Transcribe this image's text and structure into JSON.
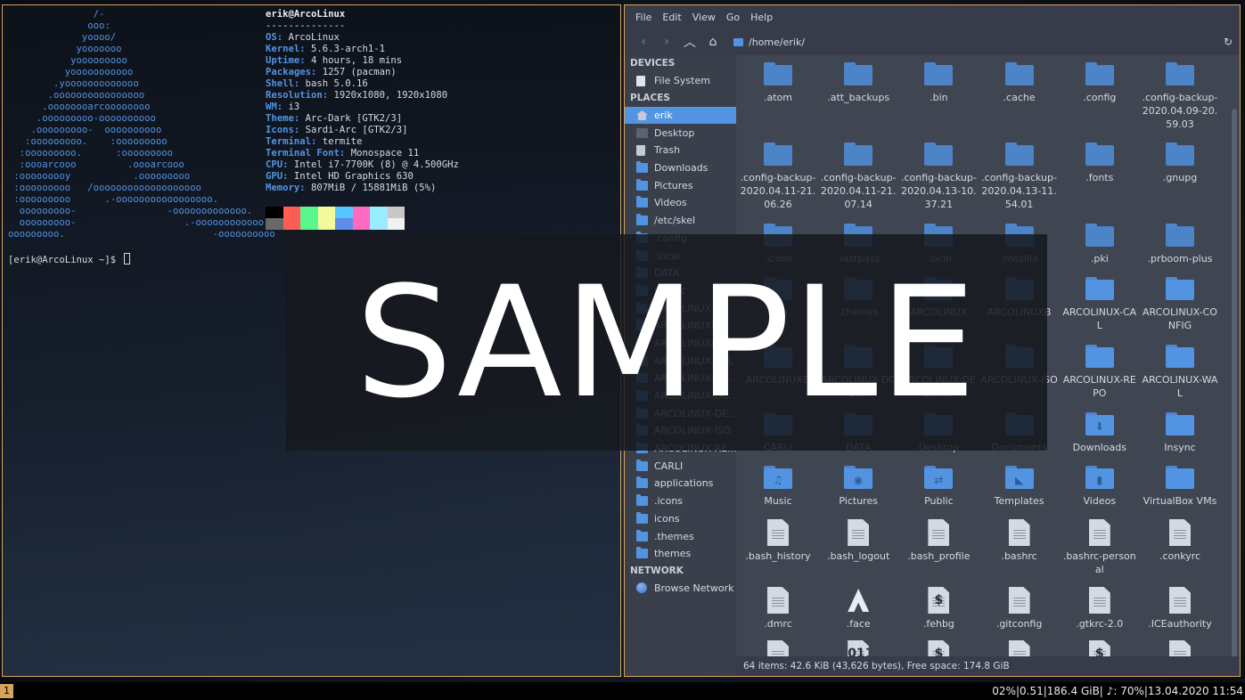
{
  "terminal": {
    "logo_lines": [
      "               /-",
      "              ooo:",
      "             yoooo/",
      "            yooooooo",
      "           yooooooooo",
      "          yooooooooooo",
      "        .yooooooooooooo",
      "       .oooooooooooooooo",
      "      .oooooooarcoooooooo",
      "     .ooooooooo-oooooooooo",
      "    .ooooooooo-  oooooooooo",
      "   :ooooooooo.    :ooooooooo",
      "  :ooooooooo.      :ooooooooo",
      "  :oooarcooo         .oooarcooo",
      " :ooooooooy           .ooooooooo",
      " :ooooooooo   /ooooooooooooooooooo",
      " :ooooooooo      .-ooooooooooooooooo.",
      "  ooooooooo-                -ooooooooooooo.",
      "  ooooooooo-                   .-oooooooooooo.",
      "ooooooooo.                          -oooooooooo"
    ],
    "title": "erik@ArcoLinux",
    "separator": "--------------",
    "info": [
      {
        "key": "OS",
        "value": "ArcoLinux"
      },
      {
        "key": "Kernel",
        "value": "5.6.3-arch1-1"
      },
      {
        "key": "Uptime",
        "value": "4 hours, 18 mins"
      },
      {
        "key": "Packages",
        "value": "1257 (pacman)"
      },
      {
        "key": "Shell",
        "value": "bash 5.0.16"
      },
      {
        "key": "Resolution",
        "value": "1920x1080, 1920x1080"
      },
      {
        "key": "WM",
        "value": "i3"
      },
      {
        "key": "Theme",
        "value": "Arc-Dark [GTK2/3]"
      },
      {
        "key": "Icons",
        "value": "Sardi-Arc [GTK2/3]"
      },
      {
        "key": "Terminal",
        "value": "termite"
      },
      {
        "key": "Terminal Font",
        "value": "Monospace 11"
      },
      {
        "key": "CPU",
        "value": "Intel i7-7700K (8) @ 4.500GHz"
      },
      {
        "key": "GPU",
        "value": "Intel HD Graphics 630"
      },
      {
        "key": "Memory",
        "value": "807MiB / 15881MiB (5%)"
      }
    ],
    "palette_top": [
      "#000000",
      "#ff5c57",
      "#5af78e",
      "#f3f99d",
      "#57c7ff",
      "#ff6ac1",
      "#9aedfe",
      "#c8c8c8"
    ],
    "palette_bottom": [
      "#686868",
      "#ff5c57",
      "#5af78e",
      "#f3f99d",
      "#5e8ee8",
      "#ff6ac1",
      "#9aedfe",
      "#f1f1f0"
    ],
    "prompt": "[erik@ArcoLinux ~]$ "
  },
  "file_manager": {
    "menu": [
      "File",
      "Edit",
      "View",
      "Go",
      "Help"
    ],
    "path": "/home/erik/",
    "sidebar": {
      "devices_header": "DEVICES",
      "devices": [
        {
          "label": "File System",
          "icon": "drive-icon"
        }
      ],
      "places_header": "PLACES",
      "places": [
        {
          "label": "erik",
          "icon": "home-icon",
          "selected": true
        },
        {
          "label": "Desktop",
          "icon": "desktop-icon"
        },
        {
          "label": "Trash",
          "icon": "trash-icon"
        },
        {
          "label": "Downloads",
          "icon": "folder-icon"
        },
        {
          "label": "Pictures",
          "icon": "folder-icon"
        },
        {
          "label": "Videos",
          "icon": "folder-icon"
        },
        {
          "label": "/etc/skel",
          "icon": "folder-icon"
        },
        {
          "label": ".config",
          "icon": "folder-icon"
        },
        {
          "label": ".local",
          "icon": "folder-icon"
        },
        {
          "label": "DATA",
          "icon": "folder-icon"
        },
        {
          "label": "Insync",
          "icon": "folder-icon"
        },
        {
          "label": "ARCOLINUX",
          "icon": "folder-icon"
        },
        {
          "label": "ARCOLINUXD",
          "icon": "folder-icon"
        },
        {
          "label": "ARCOLINUXB",
          "icon": "folder-icon"
        },
        {
          "label": "ARCOLINUX-CAL",
          "icon": "folder-icon"
        },
        {
          "label": "ARCOLINUX-CO...",
          "icon": "folder-icon"
        },
        {
          "label": "ARCOLINUX-DC...",
          "icon": "folder-icon"
        },
        {
          "label": "ARCOLINUX-DE...",
          "icon": "folder-icon"
        },
        {
          "label": "ARCOLINUX-ISO",
          "icon": "folder-icon"
        },
        {
          "label": "ARCOLINUX-RE...",
          "icon": "folder-icon"
        },
        {
          "label": "CARLI",
          "icon": "folder-icon"
        },
        {
          "label": "applications",
          "icon": "folder-icon"
        },
        {
          "label": ".icons",
          "icon": "folder-icon"
        },
        {
          "label": "icons",
          "icon": "folder-icon"
        },
        {
          "label": ".themes",
          "icon": "folder-icon"
        },
        {
          "label": "themes",
          "icon": "folder-icon"
        }
      ],
      "network_header": "NETWORK",
      "network": [
        {
          "label": "Browse Network",
          "icon": "globe-icon"
        }
      ]
    },
    "items": [
      {
        "name": ".atom",
        "type": "folder"
      },
      {
        "name": ".att_backups",
        "type": "folder"
      },
      {
        "name": ".bin",
        "type": "folder"
      },
      {
        "name": ".cache",
        "type": "folder"
      },
      {
        "name": ".config",
        "type": "folder"
      },
      {
        "name": ".config-backup-2020.04.09-20.59.03",
        "type": "folder"
      },
      {
        "name": ".config-backup-2020.04.11-21.06.26",
        "type": "folder"
      },
      {
        "name": ".config-backup-2020.04.11-21.07.14",
        "type": "folder"
      },
      {
        "name": ".config-backup-2020.04.13-10.37.21",
        "type": "folder"
      },
      {
        "name": ".config-backup-2020.04.13-11.54.01",
        "type": "folder"
      },
      {
        "name": ".fonts",
        "type": "folder"
      },
      {
        "name": ".gnupg",
        "type": "folder"
      },
      {
        "name": ".icons",
        "type": "folder"
      },
      {
        "name": ".lastpass",
        "type": "folder"
      },
      {
        "name": ".local",
        "type": "folder"
      },
      {
        "name": ".mozilla",
        "type": "folder"
      },
      {
        "name": ".pki",
        "type": "folder"
      },
      {
        "name": ".prboom-plus",
        "type": "folder"
      },
      {
        "name": ".ssh",
        "type": "folder"
      },
      {
        "name": ".themes",
        "type": "folder"
      },
      {
        "name": "ARCOLINUX",
        "type": "folder"
      },
      {
        "name": "ARCOLINUXB",
        "type": "folder"
      },
      {
        "name": "ARCOLINUX-CAL",
        "type": "folder"
      },
      {
        "name": "ARCOLINUX-CONFIG",
        "type": "folder"
      },
      {
        "name": "ARCOLINUXD",
        "type": "folder"
      },
      {
        "name": "ARCOLINUX-DCONF",
        "type": "folder"
      },
      {
        "name": "ARCOLINUX-DESKTOP",
        "type": "folder"
      },
      {
        "name": "ARCOLINUX-ISO",
        "type": "folder"
      },
      {
        "name": "ARCOLINUX-REPO",
        "type": "folder"
      },
      {
        "name": "ARCOLINUX-WAL",
        "type": "folder"
      },
      {
        "name": "CARLI",
        "type": "folder"
      },
      {
        "name": "DATA",
        "type": "folder"
      },
      {
        "name": "Desktop",
        "type": "folder"
      },
      {
        "name": "Documents",
        "type": "folder"
      },
      {
        "name": "Downloads",
        "type": "folder",
        "glyph": "⬇"
      },
      {
        "name": "Insync",
        "type": "folder"
      },
      {
        "name": "Music",
        "type": "folder",
        "glyph": "♫"
      },
      {
        "name": "Pictures",
        "type": "folder",
        "glyph": "◉"
      },
      {
        "name": "Public",
        "type": "folder",
        "glyph": "⇄"
      },
      {
        "name": "Templates",
        "type": "folder",
        "glyph": "◣"
      },
      {
        "name": "Videos",
        "type": "folder",
        "glyph": "▮"
      },
      {
        "name": "VirtualBox VMs",
        "type": "folder"
      },
      {
        "name": ".bash_history",
        "type": "doc"
      },
      {
        "name": ".bash_logout",
        "type": "doc"
      },
      {
        "name": ".bash_profile",
        "type": "doc"
      },
      {
        "name": ".bashrc",
        "type": "doc"
      },
      {
        "name": ".bashrc-personal",
        "type": "doc"
      },
      {
        "name": ".conkyrc",
        "type": "doc"
      },
      {
        "name": ".dmrc",
        "type": "doc"
      },
      {
        "name": ".face",
        "type": "arch"
      },
      {
        "name": ".fehbg",
        "type": "doc",
        "glyph": "$"
      },
      {
        "name": ".gitconfig",
        "type": "doc"
      },
      {
        "name": ".gtkrc-2.0",
        "type": "doc"
      },
      {
        "name": ".ICEauthority",
        "type": "doc"
      },
      {
        "name": "",
        "type": "doc"
      },
      {
        "name": "",
        "type": "doc",
        "glyph": "011"
      },
      {
        "name": "",
        "type": "doc",
        "glyph": "$"
      },
      {
        "name": "",
        "type": "doc"
      },
      {
        "name": "",
        "type": "doc",
        "glyph": "$"
      },
      {
        "name": "",
        "type": "doc"
      }
    ],
    "status": "64 items: 42.6 KiB (43,626 bytes), Free space: 174.8 GiB"
  },
  "bar": {
    "workspace": "1",
    "status": "02%|0.51|186.4 GiB| ♪: 70%|13.04.2020 11:54"
  },
  "watermark": "SAMPLE"
}
